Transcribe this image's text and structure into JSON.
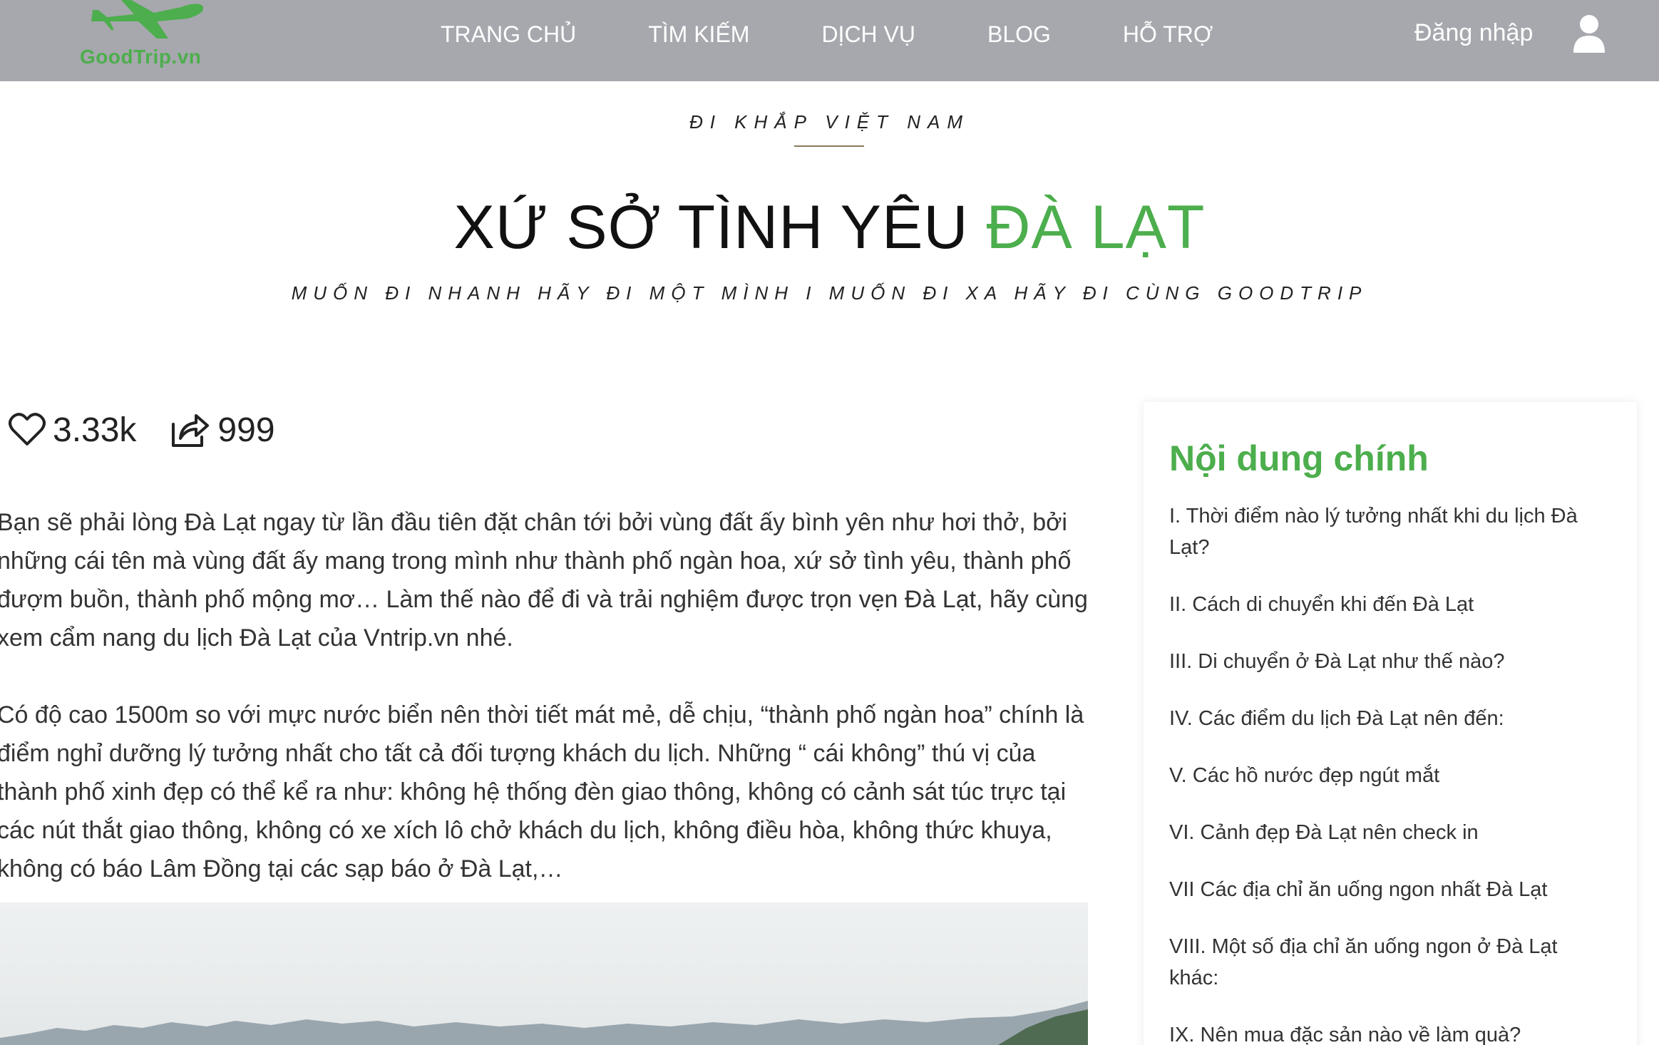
{
  "brand": {
    "logo_text": "GoodTrip.vn",
    "accent_color": "#4cae4c",
    "nav_bg": "#a6a8ad"
  },
  "nav": {
    "items": [
      {
        "label": "TRANG CHỦ"
      },
      {
        "label": "TÌM KIẾM"
      },
      {
        "label": "DỊCH VỤ"
      },
      {
        "label": "BLOG"
      },
      {
        "label": "HỖ TRỢ"
      }
    ],
    "login_label": "Đăng nhập",
    "user_icon": "user-icon"
  },
  "header": {
    "kicker": "ĐI KHẮP VIỆT NAM",
    "title_main": "XỨ SỞ TÌNH YÊU ",
    "title_accent": "ĐÀ LẠT",
    "tagline": "MUỐN ĐI NHANH HÃY ĐI MỘT MÌNH I MUỐN ĐI XA HÃY ĐI CÙNG GOODTRIP"
  },
  "stats": {
    "likes": {
      "icon": "heart-icon",
      "value": "3.33k"
    },
    "shares": {
      "icon": "share-icon",
      "value": "999"
    }
  },
  "article": {
    "paragraphs": [
      "Bạn sẽ phải lòng Đà Lạt ngay từ lần đầu tiên đặt chân tới bởi vùng đất ấy bình yên như hơi thở, bởi những cái tên mà vùng đất ấy mang trong mình như thành phố ngàn hoa, xứ sở tình yêu, thành phố đượm buồn, thành phố mộng mơ… Làm thế nào để đi và trải nghiệm được trọn vẹn Đà Lạt, hãy cùng xem cẩm nang du lịch Đà Lạt của Vntrip.vn nhé.",
      "Có độ cao 1500m so với mực nước biển nên thời tiết mát mẻ, dễ chịu, “thành phố ngàn hoa” chính là điểm nghỉ dưỡng lý tưởng nhất cho tất cả đối tượng khách du lịch. Những “ cái không” thú vị của thành phố xinh đẹp có thể kể ra như: không hệ thống đèn giao thông, không có cảnh sát túc trực tại các nút thắt giao thông, không có xe xích lô chở khách du lịch, không điều hòa, không thức khuya, không có báo Lâm Đồng tại các sạp báo ở Đà Lạt,…"
    ]
  },
  "sidebar": {
    "title": "Nội dung chính",
    "toc": [
      "I. Thời điểm nào lý tưởng nhất khi du lịch Đà Lạt?",
      "II. Cách di chuyển khi đến Đà Lạt",
      "III. Di chuyển ở Đà Lạt như thế nào?",
      "IV. Các điểm du lịch Đà Lạt nên đến:",
      "V. Các hồ nước đẹp ngút mắt",
      "VI. Cảnh đẹp Đà Lạt nên check in",
      "VII Các địa chỉ ăn uống ngon nhất Đà Lạt",
      "VIII. Một số địa chỉ ăn uống ngon ở Đà Lạt khác:",
      "IX. Nên mua đặc sản nào về làm quà?"
    ]
  }
}
